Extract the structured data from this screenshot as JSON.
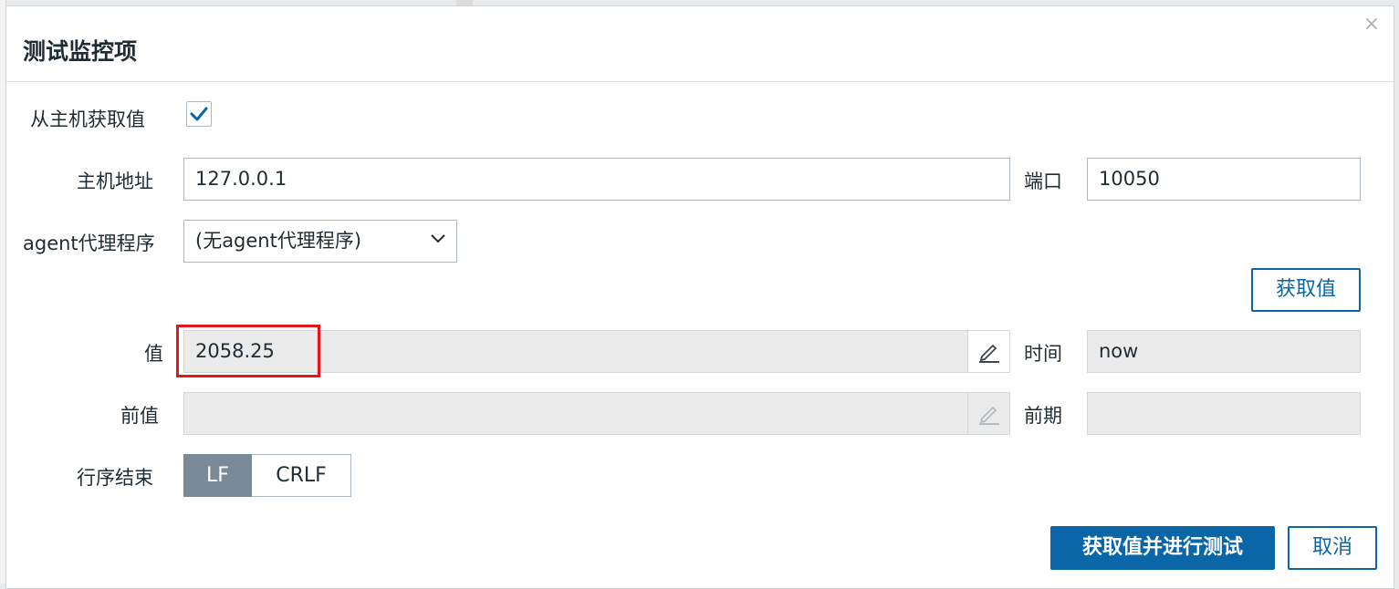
{
  "dialog": {
    "title": "测试监控项",
    "close_glyph": "×"
  },
  "form": {
    "get_from_host_label": "从主机获取值",
    "get_from_host_checked": true,
    "host_address_label": "主机地址",
    "host_address_value": "127.0.0.1",
    "port_label": "端口",
    "port_value": "10050",
    "proxy_label": "agent代理程序",
    "proxy_selected": "(无agent代理程序)",
    "get_value_button": "获取值",
    "value_label": "值",
    "value_value": "2058.25",
    "time_label": "时间",
    "time_value": "now",
    "prev_value_label": "前值",
    "prev_value_value": "",
    "prev_time_label": "前期",
    "prev_time_value": "",
    "eol_label": "行序结束",
    "eol_options": [
      "LF",
      "CRLF"
    ],
    "eol_selected": "LF"
  },
  "footer": {
    "submit_button": "获取值并进行测试",
    "cancel_button": "取消"
  },
  "colors": {
    "accent": "#0a66a7",
    "highlight": "#e8151b",
    "segment_active": "#7a8a96"
  },
  "icons": [
    "close-icon",
    "checkmark-icon",
    "chevron-down-icon",
    "pencil-icon"
  ]
}
